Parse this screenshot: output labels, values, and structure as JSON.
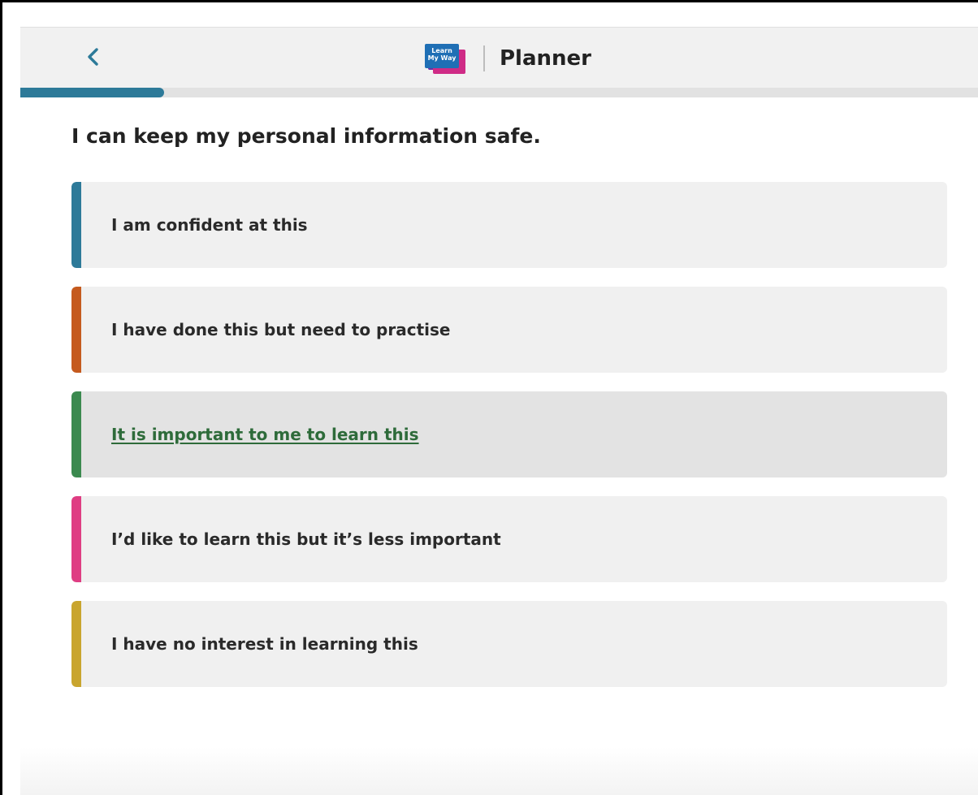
{
  "header": {
    "title": "Planner",
    "logo_text": "Learn My Way",
    "back_icon": "chevron-left-icon",
    "back_color": "#2d7a99"
  },
  "progress": {
    "fraction": 0.15,
    "color": "#2d7a99"
  },
  "question": "I can keep my personal information safe.",
  "options": [
    {
      "label": "I am confident at this",
      "color": "#2d7a99",
      "selected": false
    },
    {
      "label": "I have done this but need to practise",
      "color": "#c55a1e",
      "selected": false
    },
    {
      "label": "It is important to me to learn this",
      "color": "#3b8a4f",
      "selected": true
    },
    {
      "label": "I’d like to learn this but it’s less important",
      "color": "#df3d83",
      "selected": false
    },
    {
      "label": "I have no interest in learning this",
      "color": "#c9a52e",
      "selected": false
    }
  ]
}
